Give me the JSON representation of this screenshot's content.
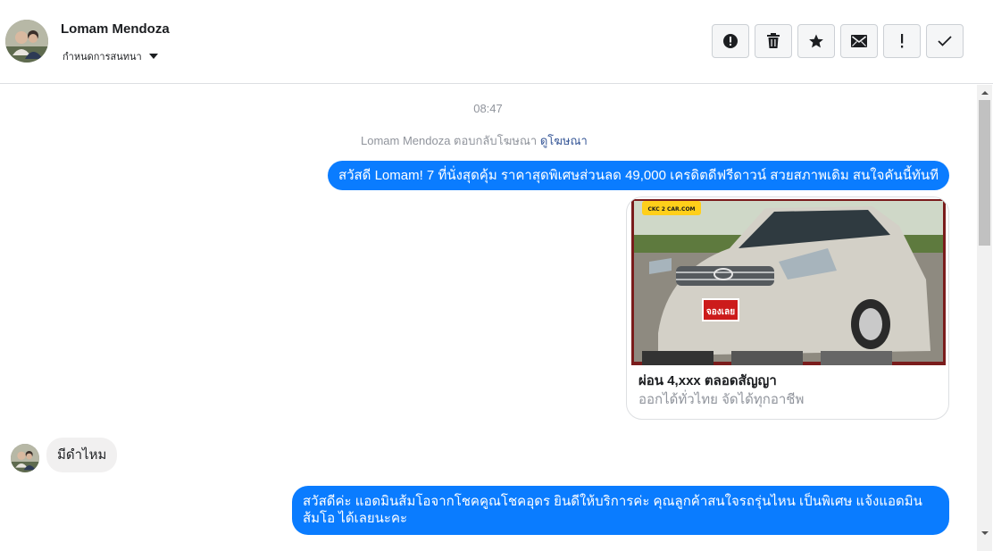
{
  "header": {
    "contact_name": "Lomam Mendoza",
    "conversation_settings": "กำหนดการสนทนา",
    "toolbar": [
      {
        "name": "report-icon",
        "symbol": "alert-circle"
      },
      {
        "name": "delete-icon",
        "symbol": "trash"
      },
      {
        "name": "star-icon",
        "symbol": "star"
      },
      {
        "name": "mail-icon",
        "symbol": "envelope"
      },
      {
        "name": "important-icon",
        "symbol": "!"
      },
      {
        "name": "done-icon",
        "symbol": "check"
      }
    ]
  },
  "thread": {
    "timestamp": "08:47",
    "ad_note_prefix": "Lomam Mendoza ตอบกลับโฆษณา",
    "ad_note_link": "ดูโฆษณา",
    "messages": [
      {
        "direction": "outgoing",
        "text": "สวัสดี Lomam! 7 ที่นั่งสุดคุ้ม ราคาสุดพิเศษส่วนลด 49,000 เครดิตดีฟรีดาวน์ สวยสภาพเดิม สนใจคันนี้ทันที"
      },
      {
        "direction": "outgoing",
        "type": "ad_card",
        "image_badge": "CKC 2 CAR.COM",
        "sticker": "จองเลย",
        "title": "ผ่อน 4,xxx ตลอดสัญญา",
        "subtitle": "ออกได้ทั่วไทย จัดได้ทุกอาชีพ"
      },
      {
        "direction": "incoming",
        "text": "มีดำไหม"
      },
      {
        "direction": "outgoing",
        "text": "สวัสดีค่ะ แอดมินส้มโอจากโชคคูณโชคอุดร ยินดีให้บริการค่ะ   คุณลูกค้าสนใจรถรุ่นไหน เป็นพิเศษ แจ้งแอดมินส้มโอ ได้เลยนะคะ"
      }
    ]
  },
  "colors": {
    "outgoing_bubble": "#0a7cff",
    "incoming_bubble": "#f1f0f0",
    "link": "#385898",
    "meta_text": "#90949c"
  }
}
